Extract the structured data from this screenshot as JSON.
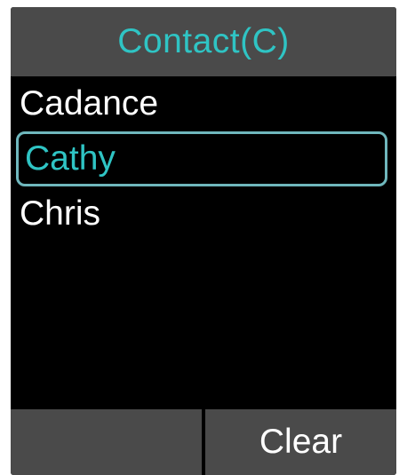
{
  "header": {
    "title": "Contact(C)"
  },
  "contacts": [
    {
      "name": "Cadance",
      "selected": false
    },
    {
      "name": "Cathy",
      "selected": true
    },
    {
      "name": "Chris",
      "selected": false
    }
  ],
  "softkeys": {
    "left_label": "",
    "right_label": "Clear"
  },
  "colors": {
    "accent": "#2fc4c4",
    "selection_border": "#6fb7bd",
    "bar_background": "#4a4a4a",
    "screen_background": "#000000",
    "text": "#ffffff"
  }
}
